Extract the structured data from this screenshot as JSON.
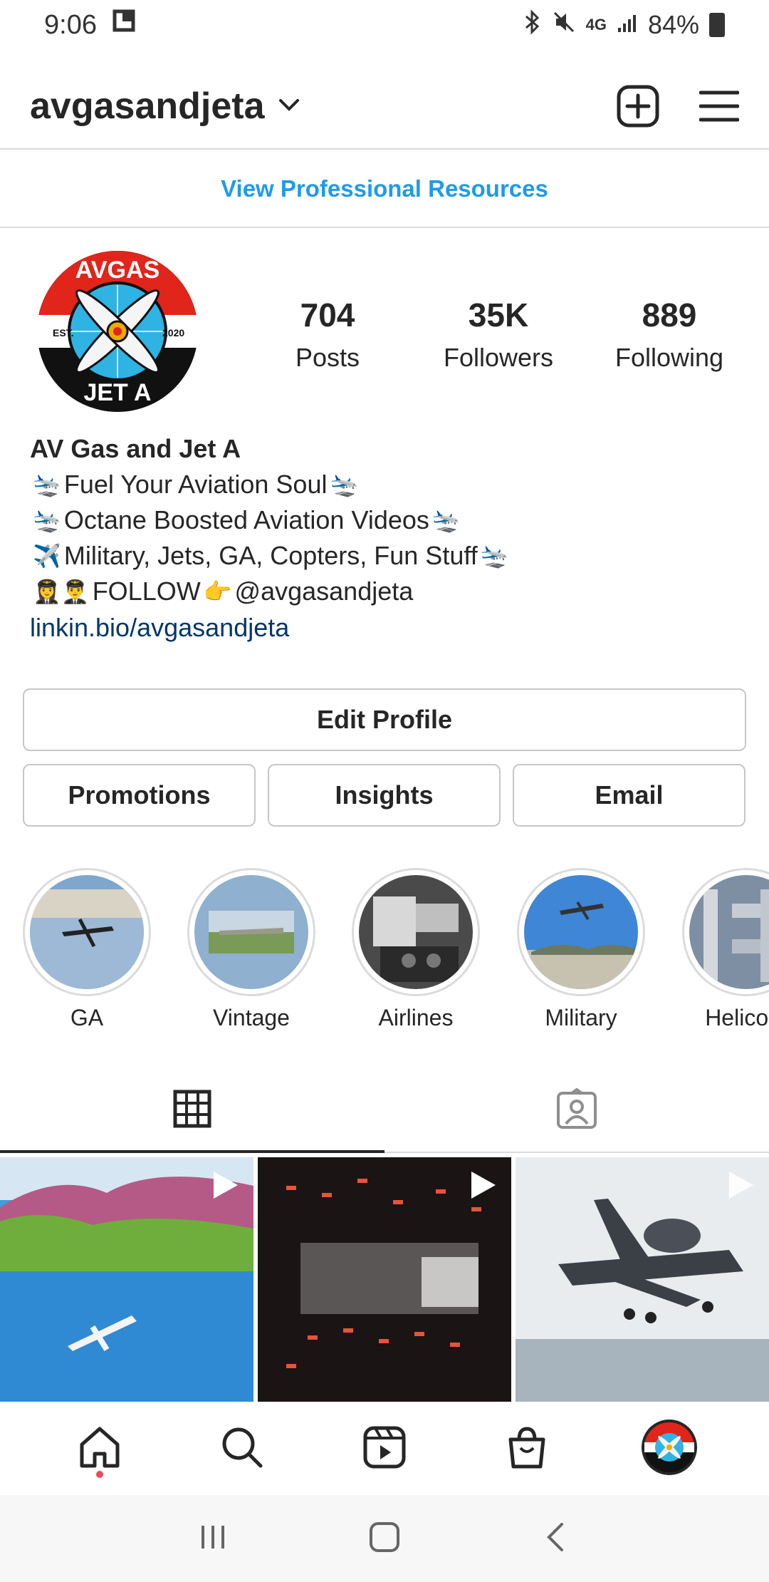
{
  "status_bar": {
    "time": "9:06",
    "network": "4G",
    "battery": "84%"
  },
  "header": {
    "username": "avgasandjeta"
  },
  "pro_resources": {
    "label": "View Professional Resources"
  },
  "profile": {
    "stats": [
      {
        "value": "704",
        "label": "Posts"
      },
      {
        "value": "35K",
        "label": "Followers"
      },
      {
        "value": "889",
        "label": "Following"
      }
    ],
    "avatar_text": {
      "top": "AVGAS",
      "bottom": "JET A",
      "left": "EST.",
      "right": "2020"
    }
  },
  "bio": {
    "name": "AV Gas and Jet A",
    "lines": [
      "Fuel Your Aviation Soul",
      "Octane Boosted Aviation Videos",
      "Military, Jets, GA, Copters, Fun Stuff",
      "FOLLOW",
      "@avgasandjeta"
    ],
    "emoji": {
      "plane_left": "🛬",
      "plane_right": "🛬",
      "airplane": "✈️",
      "pilots": "👩‍✈️👨‍✈️",
      "point": "👉"
    },
    "link": "linkin.bio/avgasandjeta"
  },
  "buttons": {
    "edit_profile": "Edit Profile",
    "promotions": "Promotions",
    "insights": "Insights",
    "email": "Email"
  },
  "highlights": [
    {
      "label": "GA"
    },
    {
      "label": "Vintage"
    },
    {
      "label": "Airlines"
    },
    {
      "label": "Military"
    },
    {
      "label": "Helicopt"
    }
  ],
  "colors": {
    "link_blue": "#1f9be6",
    "bio_link": "#00376b",
    "border": "#dbdbdb",
    "notification_dot": "#ed4956"
  }
}
